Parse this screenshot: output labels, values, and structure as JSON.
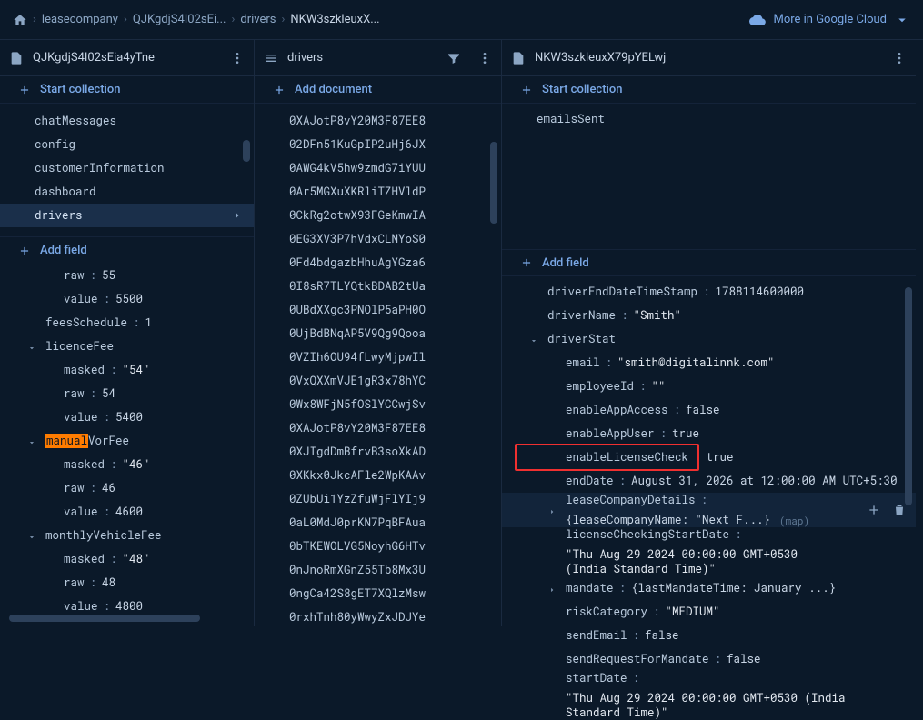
{
  "breadcrumb": {
    "items": [
      "leasecompany",
      "QJKgdjS4I02sEi...",
      "drivers",
      "NKW3szkleuxX..."
    ]
  },
  "morecloud": "More in Google Cloud",
  "col1": {
    "title": "QJKgdjS4I02sEia4yTne",
    "start_collection": "Start collection",
    "add_field": "Add field",
    "collections": [
      "chatMessages",
      "config",
      "customerInformation",
      "dashboard",
      "drivers"
    ],
    "fields": [
      {
        "k": "raw",
        "v": "55",
        "indent": 1,
        "type": "num"
      },
      {
        "k": "value",
        "v": "5500",
        "indent": 1,
        "type": "num"
      },
      {
        "k": "feesSchedule",
        "v": "1",
        "indent": 0,
        "type": "num"
      },
      {
        "k": "licenceFee",
        "v": "",
        "indent": 0,
        "type": "map",
        "disc": true
      },
      {
        "k": "masked",
        "v": "\"54\"",
        "indent": 1,
        "type": "str"
      },
      {
        "k": "raw",
        "v": "54",
        "indent": 1,
        "type": "num"
      },
      {
        "k": "value",
        "v": "5400",
        "indent": 1,
        "type": "num"
      },
      {
        "k": "VorFee",
        "v": "",
        "indent": 0,
        "type": "map",
        "disc": true,
        "prefixhl": "manual"
      },
      {
        "k": "masked",
        "v": "\"46\"",
        "indent": 1,
        "type": "str"
      },
      {
        "k": "raw",
        "v": "46",
        "indent": 1,
        "type": "num"
      },
      {
        "k": "value",
        "v": "4600",
        "indent": 1,
        "type": "num"
      },
      {
        "k": "monthlyVehicleFee",
        "v": "",
        "indent": 0,
        "type": "map",
        "disc": true
      },
      {
        "k": "masked",
        "v": "\"48\"",
        "indent": 1,
        "type": "str"
      },
      {
        "k": "raw",
        "v": "48",
        "indent": 1,
        "type": "num"
      },
      {
        "k": "value",
        "v": "4800",
        "indent": 1,
        "type": "num"
      }
    ]
  },
  "col2": {
    "title": "drivers",
    "add_document": "Add document",
    "docs": [
      "0XAJotP8vY20M3F87EE8",
      "02DFn51KuGpIP2uHj6JX",
      "0AWG4kV5hw9zmdG7iYUU",
      "0Ar5MGXuXKRliTZHVldP",
      "0CkRg2otwX93FGeKmwIA",
      "0EG3XV3P7hVdxCLNYoS0",
      "0Fd4bdgazbHhuAgYGza6",
      "0I8sR7TLYQtkBDAB2tUa",
      "0UBdXXgc3PNOlP5aPH0O",
      "0UjBdBNqAP5V9Qg9Qooa",
      "0VZIh6OU94fLwyMjpwIl",
      "0VxQXXmVJE1gR3x78hYC",
      "0Wx8WFjN5fOSlYCCwjSv",
      "0XAJotP8vY20M3F87EE8",
      "0XJIgdDmBfrvB3soXkAD",
      "0XKkx0JkcAFle2WpKAAv",
      "0ZUbUi1YzZfuWjFlYIj9",
      "0aL0MdJ0prKN7PqBFAua",
      "0bTKEWOLVG5NoyhG6HTv",
      "0nJnoRmXGnZ55Tb8Mx3U",
      "0ngCa42S8gET7XQlzMsw",
      "0rxhTnh80yWwyZxJDJYe"
    ]
  },
  "col3": {
    "title": "NKW3szkleuxX79pYELwj",
    "start_collection": "Start collection",
    "subcollections": [
      "emailsSent"
    ],
    "add_field": "Add field",
    "fields": [
      {
        "k": "driverEndDateTimeStamp",
        "v": "1788114600000",
        "type": "num"
      },
      {
        "k": "driverName",
        "v": "\"Smith\"",
        "type": "str"
      },
      {
        "k": "driverStat",
        "v": "",
        "type": "map",
        "disc": true
      },
      {
        "k": "email",
        "v": "\"smith@digitalinnk.com\"",
        "type": "str",
        "indent": 1
      },
      {
        "k": "employeeId",
        "v": "\"\"",
        "type": "str",
        "indent": 1
      },
      {
        "k": "enableAppAccess",
        "v": "false",
        "type": "bool",
        "indent": 1
      },
      {
        "k": "enableAppUser",
        "v": "true",
        "type": "bool",
        "indent": 1
      },
      {
        "k": "enableLicenseCheck",
        "v": "true",
        "type": "bool",
        "indent": 1,
        "red": true
      },
      {
        "k": "endDate",
        "v": "August 31, 2026 at 12:00:00 AM UTC+5:30",
        "type": "plain",
        "indent": 1
      },
      {
        "k": "leaseCompanyDetails",
        "v": "{leaseCompanyName: \"Next F...}",
        "type": "mapinline",
        "indent": 1,
        "hint": "(map)",
        "hover": true,
        "icons": true,
        "disc": "closed"
      },
      {
        "k": "licenseCheckingStartDate",
        "v": "\"Thu Aug 29 2024 00:00:00 GMT+0530 (India Standard Time)\"",
        "type": "str",
        "indent": 1,
        "wrap": true
      },
      {
        "k": "mandate",
        "v": "{lastMandateTime: January ...}",
        "type": "mapinline",
        "indent": 1,
        "disc": "closed"
      },
      {
        "k": "riskCategory",
        "v": "\"MEDIUM\"",
        "type": "str",
        "indent": 1
      },
      {
        "k": "sendEmail",
        "v": "false",
        "type": "bool",
        "indent": 1
      },
      {
        "k": "sendRequestForMandate",
        "v": "false",
        "type": "bool",
        "indent": 1
      },
      {
        "k": "startDate",
        "v": "\"Thu Aug 29 2024 00:00:00 GMT+0530 (India Standard Time)\"",
        "type": "str",
        "indent": 1
      }
    ]
  }
}
